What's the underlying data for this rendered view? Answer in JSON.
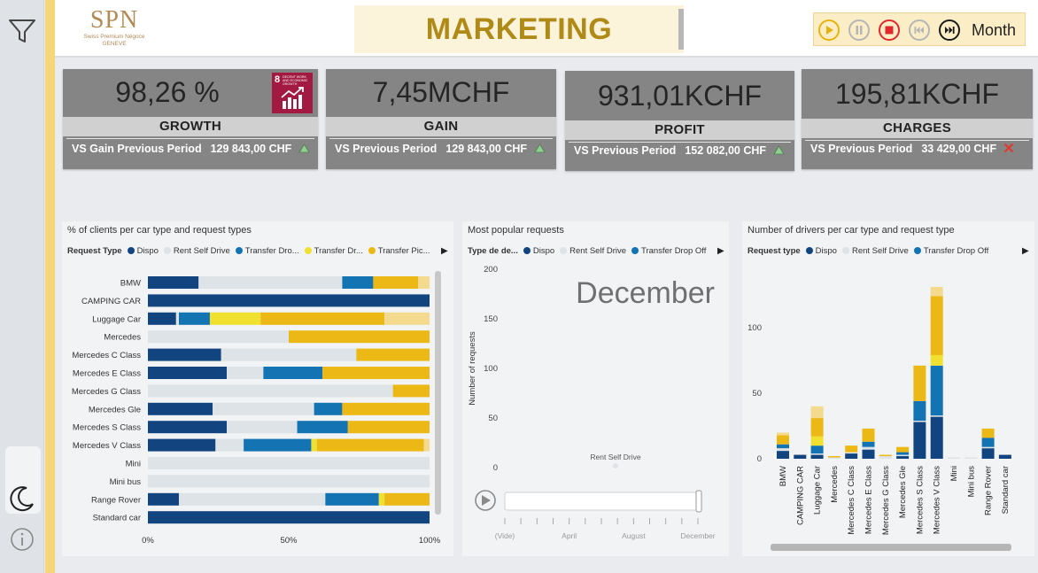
{
  "logo": {
    "main": "SPN",
    "sub1": "Swiss Premium Négoce",
    "sub2": "GENEVE"
  },
  "header": {
    "title": "MARKETING"
  },
  "player": {
    "period_label": "Month"
  },
  "colors": {
    "dispo": "#12447f",
    "rent_self_drive": "#dde3e6",
    "transfer_drop_off": "#1473b3",
    "transfer_dr": "#f0e131",
    "transfer_pick": "#ecb815",
    "transfer_light": "#f3da8f",
    "kpi_bg": "#858585",
    "accent_gold": "#b08a16",
    "up_arrow": "#8fcf90",
    "down_cross": "#e03a2c"
  },
  "kpis": [
    {
      "value": "98,26 %",
      "label": "GROWTH",
      "compare_label": "VS Gain Previous Period",
      "compare_value": "129 843,00 CHF",
      "trend": "up"
    },
    {
      "value": "7,45MCHF",
      "label": "GAIN",
      "compare_label": "VS Previous Period",
      "compare_value": "129 843,00 CHF",
      "trend": "up"
    },
    {
      "value": "931,01KCHF",
      "label": "PROFIT",
      "compare_label": "VS Previous Period",
      "compare_value": "152 082,00 CHF",
      "trend": "up"
    },
    {
      "value": "195,81KCHF",
      "label": "CHARGES",
      "compare_label": "VS Previous Period",
      "compare_value": "33 429,00 CHF",
      "trend": "down"
    }
  ],
  "sdg": {
    "number": "8",
    "text": "DECENT WORK AND ECONOMIC GROWTH"
  },
  "charts": {
    "pct": {
      "title": "% of clients per car type and request types",
      "legend_title": "Request Type",
      "legend": [
        "Dispo",
        "Rent Self Drive",
        "Transfer Dro...",
        "Transfer Dr...",
        "Transfer Pic..."
      ]
    },
    "popular": {
      "title": "Most popular requests",
      "legend_title": "Type de de...",
      "legend": [
        "Dispo",
        "Rent Self Drive",
        "Transfer Drop Off"
      ]
    },
    "drivers": {
      "title": "Number of drivers per car type and request type",
      "legend_title": "Request type",
      "legend": [
        "Dispo",
        "Rent Self Drive",
        "Transfer Drop Off"
      ]
    }
  },
  "chart_data": [
    {
      "type": "bar",
      "orientation": "horizontal-stacked-100",
      "title": "% of clients per car type and request types",
      "xlim": [
        0,
        100
      ],
      "x_ticks": [
        "0%",
        "50%",
        "100%"
      ],
      "categories": [
        "BMW",
        "CAMPING CAR",
        "Luggage Car",
        "Mercedes",
        "Mercedes C Class",
        "Mercedes E Class",
        "Mercedes G Class",
        "Mercedes Gle",
        "Mercedes S Class",
        "Mercedes V Class",
        "Mini",
        "Mini bus",
        "Range Rover",
        "Standard car"
      ],
      "series": [
        {
          "name": "Dispo",
          "color": "#12447f",
          "values": [
            18,
            100,
            10,
            0,
            26,
            28,
            0,
            23,
            28,
            24,
            0,
            0,
            11,
            100
          ]
        },
        {
          "name": "Rent Self Drive",
          "color": "#dde3e6",
          "values": [
            51,
            0,
            1,
            50,
            48,
            13,
            87,
            36,
            25,
            10,
            100,
            100,
            52,
            0
          ]
        },
        {
          "name": "Transfer Dro...",
          "color": "#1473b3",
          "values": [
            11,
            0,
            11,
            0,
            0,
            21,
            0,
            10,
            18,
            24,
            0,
            0,
            19,
            0
          ]
        },
        {
          "name": "Transfer Dr...",
          "color": "#f0e131",
          "values": [
            0,
            0,
            18,
            0,
            0,
            0,
            0,
            0,
            0,
            2,
            0,
            0,
            2,
            0
          ]
        },
        {
          "name": "Transfer Pic...",
          "color": "#ecb815",
          "values": [
            16,
            0,
            44,
            50,
            26,
            38,
            13,
            31,
            29,
            38,
            0,
            0,
            16,
            0
          ]
        },
        {
          "color": "#f3da8f",
          "values": [
            4,
            0,
            16,
            0,
            0,
            0,
            0,
            0,
            0,
            2,
            0,
            0,
            0,
            0
          ]
        }
      ]
    },
    {
      "type": "scatter",
      "title": "Most popular requests",
      "ylabel": "Number of requests",
      "ylim": [
        0,
        200
      ],
      "y_ticks": [
        0,
        50,
        100,
        150,
        200
      ],
      "highlight_label": "December",
      "points": [
        {
          "label": "Rent Self Drive",
          "y": 0
        }
      ],
      "play_axis": {
        "ticks": [
          "(Vide)",
          "April",
          "August",
          "December"
        ],
        "current": "December"
      }
    },
    {
      "type": "bar",
      "orientation": "vertical-stacked",
      "title": "Number of drivers per car type and request type",
      "ylim": [
        0,
        135
      ],
      "y_ticks": [
        0,
        50,
        100
      ],
      "categories": [
        "BMW",
        "CAMPING CAR",
        "Luggage Car",
        "Mercedes",
        "Mercedes C Class",
        "Mercedes E Class",
        "Mercedes G Class",
        "Mercedes Gle",
        "Mercedes S Class",
        "Mercedes V Class",
        "Mini",
        "Mini bus",
        "Range Rover",
        "Standard car"
      ],
      "series": [
        {
          "name": "Dispo",
          "color": "#12447f",
          "values": [
            6,
            3,
            3,
            0,
            4,
            7,
            0,
            2,
            28,
            32,
            0,
            0,
            8,
            3
          ]
        },
        {
          "name": "Rent Self Drive",
          "color": "#dde3e6",
          "values": [
            2,
            0,
            1,
            1,
            1,
            2,
            2,
            1,
            1,
            1,
            1,
            1,
            1,
            0
          ]
        },
        {
          "name": "Transfer Drop Off",
          "color": "#1473b3",
          "values": [
            3,
            0,
            6,
            0,
            0,
            4,
            0,
            2,
            15,
            38,
            0,
            0,
            7,
            0
          ]
        },
        {
          "color": "#f0e131",
          "values": [
            0,
            0,
            7,
            0,
            0,
            0,
            0,
            0,
            0,
            8,
            0,
            0,
            0,
            0
          ]
        },
        {
          "color": "#ecb815",
          "values": [
            7,
            0,
            14,
            1,
            5,
            10,
            1,
            4,
            27,
            45,
            0,
            0,
            7,
            0
          ]
        },
        {
          "color": "#f3da8f",
          "values": [
            2,
            0,
            9,
            0,
            0,
            0,
            0,
            0,
            0,
            7,
            0,
            0,
            0,
            0
          ]
        }
      ]
    }
  ]
}
